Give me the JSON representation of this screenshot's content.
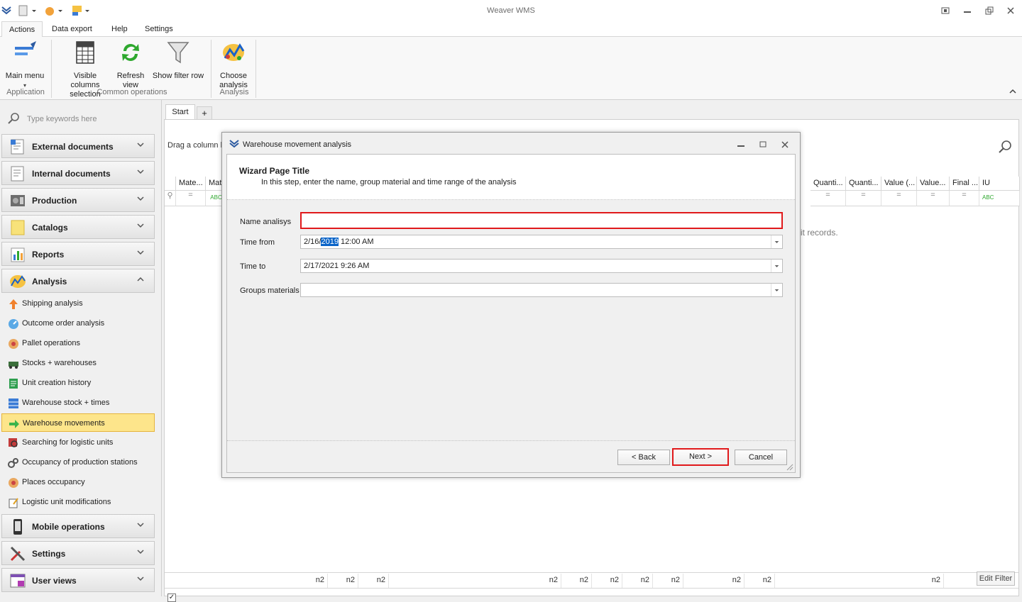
{
  "app": {
    "title": "Weaver WMS"
  },
  "menu_tabs": [
    "Actions",
    "Data export",
    "Help",
    "Settings"
  ],
  "ribbon": {
    "main_menu": "Main menu",
    "visible_columns": [
      "Visible columns",
      "selection"
    ],
    "refresh": [
      "Refresh",
      "view"
    ],
    "show_filter": "Show filter row",
    "choose_analysis": [
      "Choose",
      "analysis"
    ],
    "groups": [
      "Application",
      "Common operations",
      "Analysis"
    ]
  },
  "sidebar": {
    "search_placeholder": "Type keywords here",
    "groups": {
      "external": "External documents",
      "internal": "Internal documents",
      "production": "Production",
      "catalogs": "Catalogs",
      "reports": "Reports",
      "analysis": "Analysis",
      "mobile": "Mobile operations",
      "settings": "Settings",
      "userviews": "User views"
    },
    "analysis_items": [
      "Shipping analysis",
      "Outcome order analysis",
      "Pallet operations",
      "Stocks + warehouses",
      "Unit creation history",
      "Warehouse stock + times",
      "Warehouse movements",
      "Searching for logistic units",
      "Occupancy of production stations",
      "Places occupancy",
      "Logistic unit modifications"
    ]
  },
  "main": {
    "tabs": [
      "Start",
      "+"
    ],
    "group_hint": "Drag a column h",
    "columns_left": [
      "Mate...",
      "Mat"
    ],
    "columns_right": [
      "Quanti...",
      "Quanti...",
      "Value (...",
      "Value...",
      "Final ...",
      "IU"
    ],
    "no_records": "it records.",
    "footer_values": [
      "n2",
      "n2",
      "n2",
      "n2",
      "n2",
      "n2",
      "n2",
      "n2",
      "n2",
      "n2",
      "n2"
    ],
    "edit_filter": "Edit Filter"
  },
  "dialog": {
    "title": "Warehouse movement analysis",
    "page_title": "Wizard Page Title",
    "description": "In this step, enter the name, group material and time range of the analysis",
    "fields": {
      "name_label": "Name analisys",
      "name_value": "",
      "time_from_label": "Time from",
      "time_from_pre": "2/16/",
      "time_from_sel": "2019",
      "time_from_post": " 12:00 AM",
      "time_to_label": "Time to",
      "time_to_value": "2/17/2021 9:26 AM",
      "groups_label": "Groups materials",
      "groups_value": ""
    },
    "buttons": {
      "back": "< Back",
      "next": "Next >",
      "cancel": "Cancel"
    }
  }
}
